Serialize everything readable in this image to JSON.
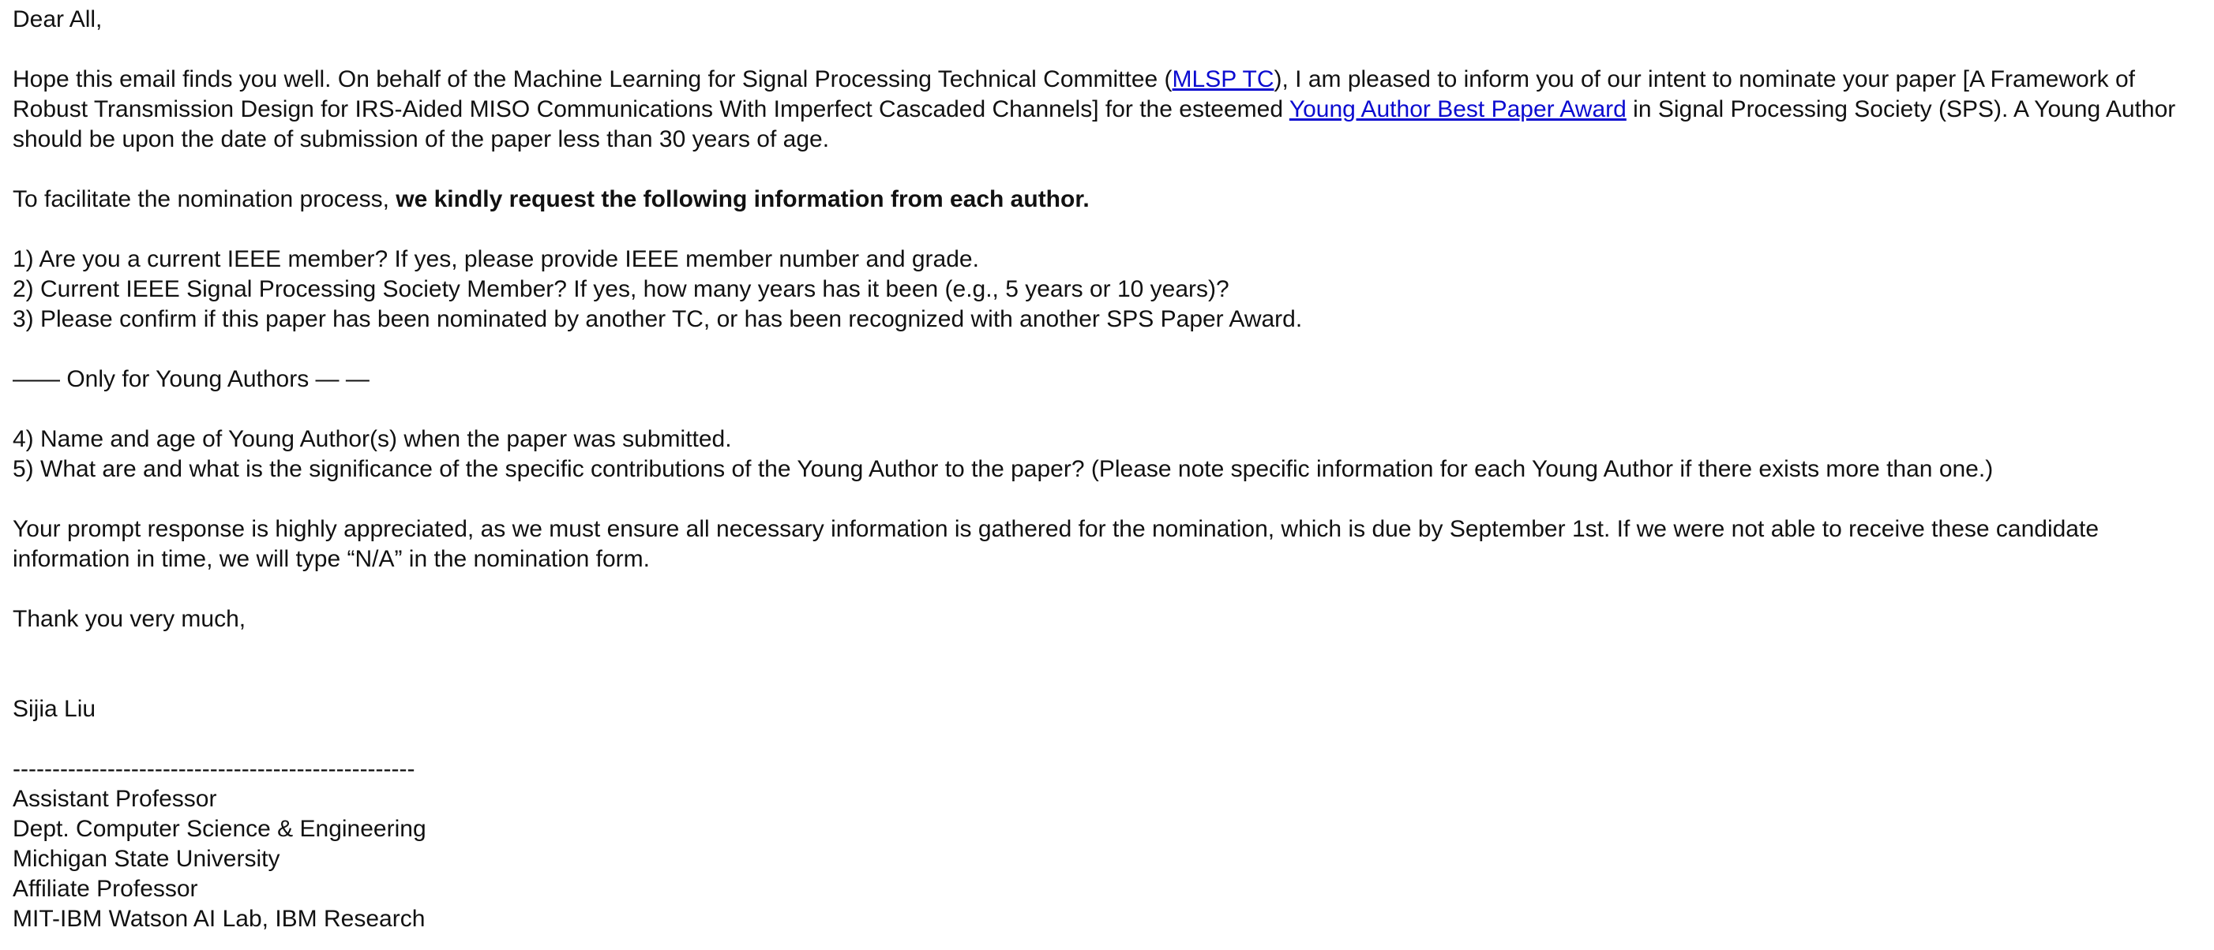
{
  "greeting": "Dear All,",
  "intro": {
    "part1": "Hope this email finds you well. On behalf of the Machine Learning for Signal Processing Technical Committee (",
    "mlsp_link": "MLSP TC",
    "part2": "), I am pleased to inform you of our intent to nominate your paper [A Framework of Robust Transmission Design for IRS-Aided MISO Communications With Imperfect Cascaded Channels] for the esteemed ",
    "award_link": "Young Author Best Paper Award",
    "part3": " in Signal Processing Society (SPS). A Young Author should be upon the date of submission of the paper less than 30 years of age."
  },
  "request": {
    "plain": "To facilitate the nomination process, ",
    "bold": "we kindly request the following information from each author."
  },
  "questions": [
    "1) Are you a current IEEE member? If yes, please provide IEEE member number and grade.",
    "2) Current IEEE Signal Processing Society Member? If yes, how many years has it been (e.g., 5 years or 10 years)?",
    "3) Please confirm if this paper has been nominated by another TC, or has been recognized with another SPS Paper Award."
  ],
  "young_divider": "—— Only for Young Authors — —",
  "young_questions": [
    "4) Name and age of Young Author(s) when the paper was submitted.",
    "5) What are and what is the significance of the specific contributions of the Young Author to the paper? (Please note specific information for each Young Author if there exists more than one.)"
  ],
  "response_note": "Your prompt response is highly appreciated, as we must ensure all necessary information is gathered for the nomination, which is due by September 1st. If we were not able to receive these candidate information in time, we will type “N/A” in the nomination form.",
  "closing": "Thank you very much,",
  "signature": {
    "name": "Sijia Liu",
    "separator": "---------------------------------------------------",
    "lines": [
      "Assistant Professor",
      "Dept. Computer Science & Engineering",
      "Michigan State University",
      "Affiliate Professor",
      "MIT-IBM Watson AI Lab, IBM Research"
    ]
  },
  "colors": {
    "text": "#111111",
    "link": "#0b0bd0",
    "background": "#ffffff"
  }
}
